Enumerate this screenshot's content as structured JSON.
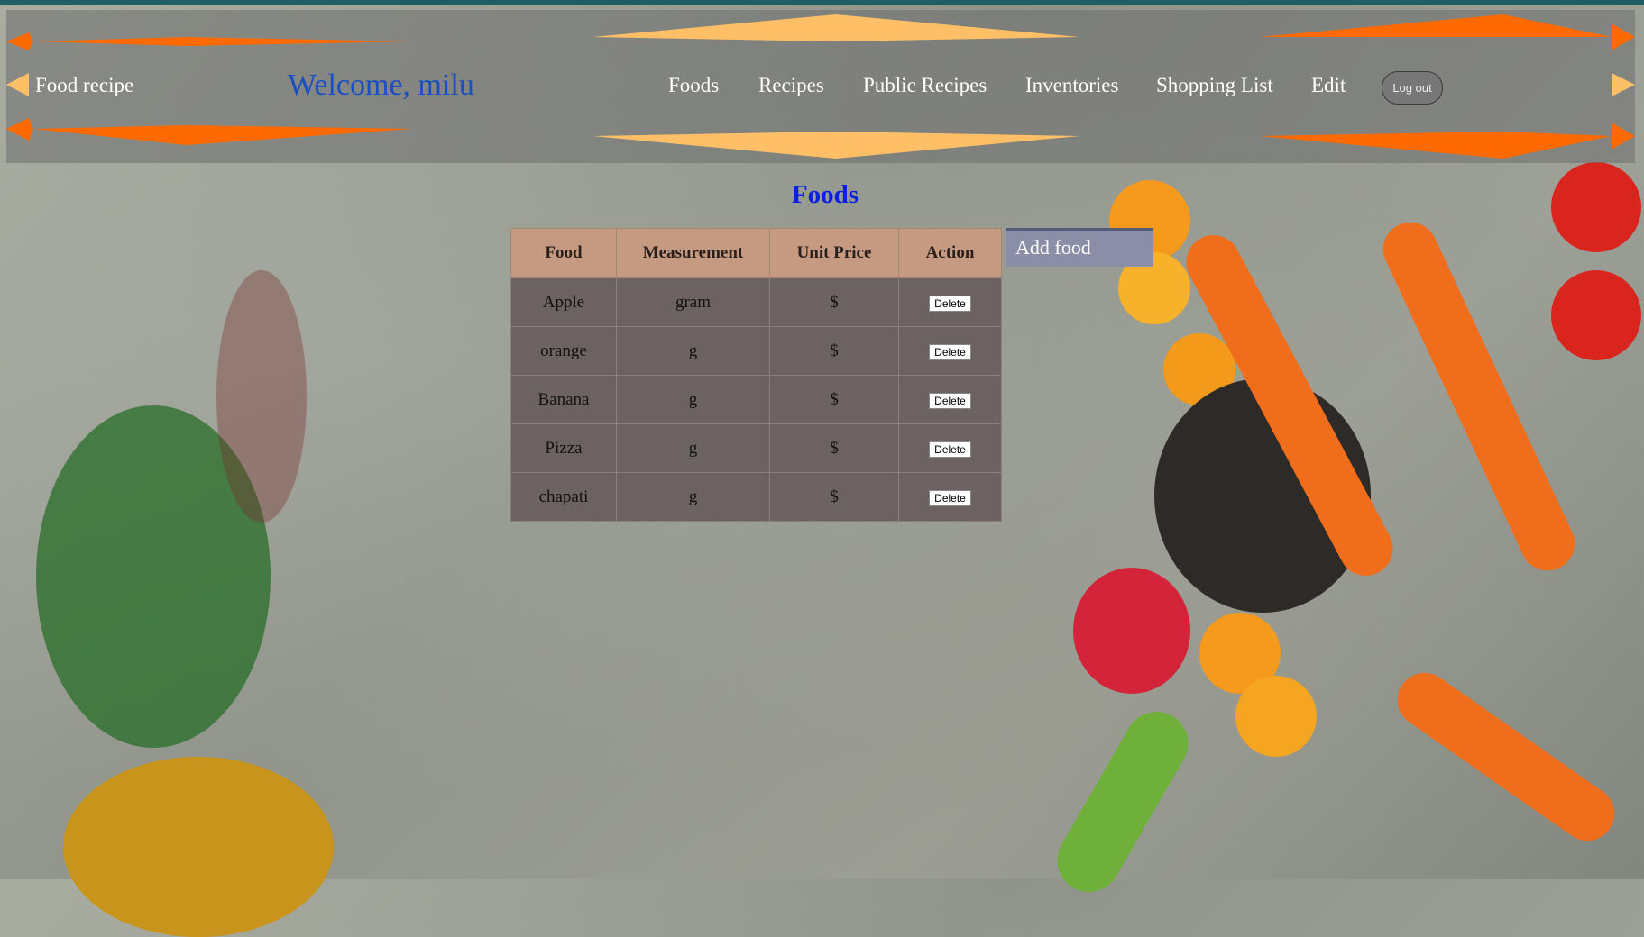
{
  "navbar": {
    "brand": "Food recipe",
    "welcome": "Welcome, milu",
    "links": [
      "Foods",
      "Recipes",
      "Public Recipes",
      "Inventories",
      "Shopping List",
      "Edit"
    ],
    "logout_label": "Log out"
  },
  "page_title": "Foods",
  "table": {
    "headers": [
      "Food",
      "Measurement",
      "Unit Price",
      "Action"
    ],
    "rows": [
      {
        "food": "Apple",
        "measurement": "gram",
        "price": "$",
        "action": "Delete"
      },
      {
        "food": "orange",
        "measurement": "g",
        "price": "$",
        "action": "Delete"
      },
      {
        "food": "Banana",
        "measurement": "g",
        "price": "$",
        "action": "Delete"
      },
      {
        "food": "Pizza",
        "measurement": "g",
        "price": "$",
        "action": "Delete"
      },
      {
        "food": "chapati",
        "measurement": "g",
        "price": "$",
        "action": "Delete"
      }
    ]
  },
  "add_food_label": "Add food",
  "colors": {
    "welcome": "#1a4fc2",
    "title": "#0b1ee6",
    "table_header": "#c59a80",
    "table_row": "#6c6262",
    "add_button": "#8a8ea6",
    "deco_orange": "#ff6a00",
    "deco_yellow": "#ffbf66"
  }
}
